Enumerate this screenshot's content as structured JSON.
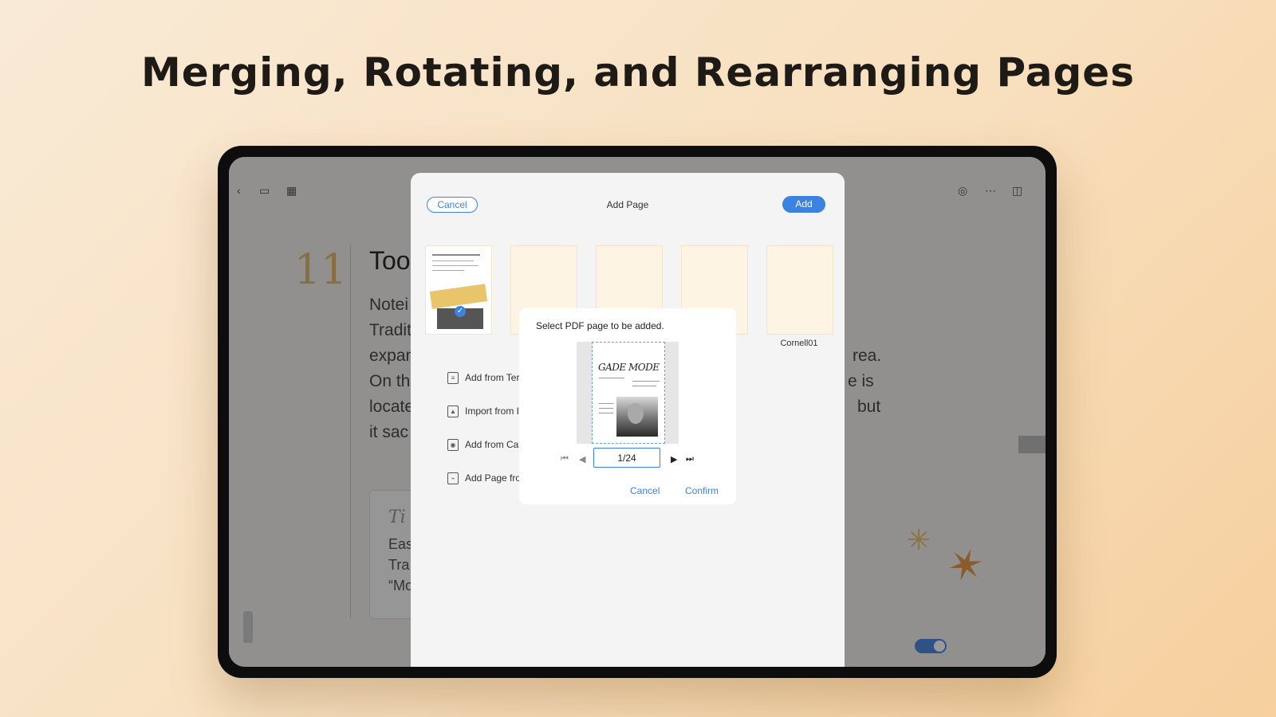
{
  "headline": "Merging, Rotating, and Rearranging Pages",
  "background_note": {
    "number": "11",
    "title": "Too",
    "lines": [
      "Notei",
      "Tradit",
      "expan",
      "On th",
      "locate",
      "it sac"
    ],
    "right_fragments": [
      "rea.",
      "e is",
      "but"
    ],
    "tip_title": "Ti",
    "tip_lines": [
      "Eas",
      "Tra",
      "“Mo"
    ]
  },
  "add_page_sheet": {
    "cancel_label": "Cancel",
    "title": "Add Page",
    "add_label": "Add",
    "template_label": "Cornell01",
    "menu": [
      {
        "icon": "template-icon",
        "label": "Add from Ter"
      },
      {
        "icon": "image-icon",
        "label": "Import from I"
      },
      {
        "icon": "camera-icon",
        "label": "Add from Ca"
      },
      {
        "icon": "pdf-icon",
        "label": "Add Page fro"
      }
    ]
  },
  "dialog": {
    "title": "Select PDF page to be added.",
    "pdf_masthead": "GADE MODE",
    "page_indicator": "1/24",
    "cancel_label": "Cancel",
    "confirm_label": "Confirm"
  },
  "colors": {
    "accent": "#3c82e0",
    "template_paper": "#fdf4e3",
    "note_number": "#e2b96a"
  }
}
